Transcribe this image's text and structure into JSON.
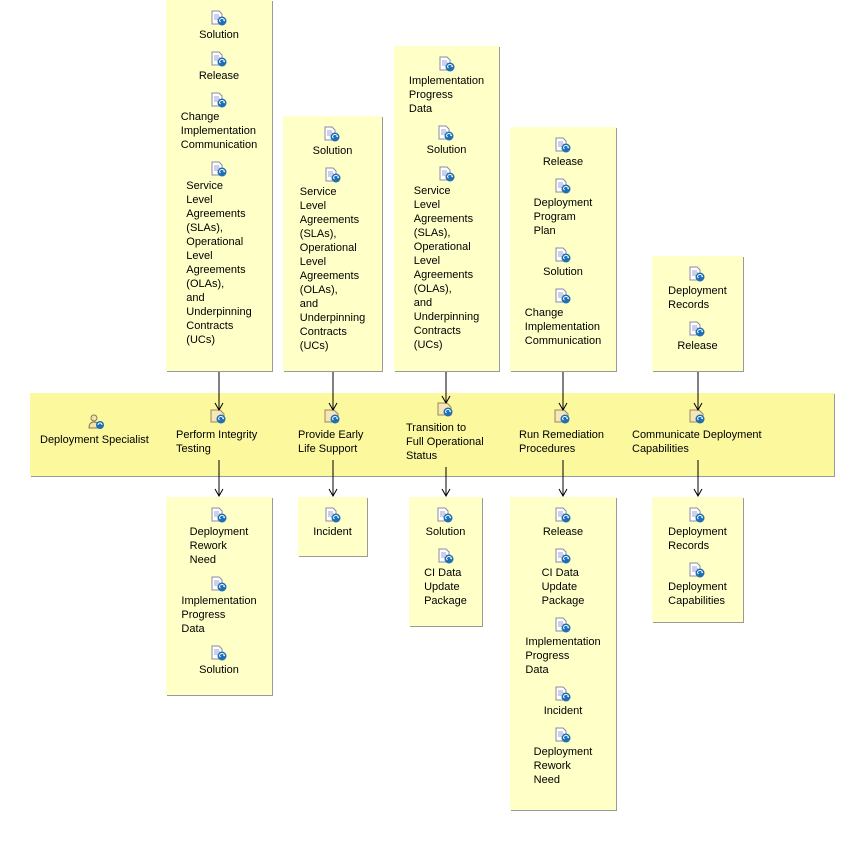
{
  "lane": {
    "role": "Deployment Specialist",
    "role_icon": "role-icon"
  },
  "tasks": [
    {
      "label": "Perform Integrity\nTesting",
      "inputs": [
        "Solution",
        "Release",
        "Change\nImplementation\nCommunication",
        "Service\nLevel\nAgreements\n(SLAs),\nOperational\nLevel\nAgreements\n(OLAs),\nand\nUnderpinning\nContracts\n(UCs)"
      ],
      "outputs": [
        "Deployment\nRework\nNeed",
        "Implementation\nProgress\nData",
        "Solution"
      ]
    },
    {
      "label": "Provide Early\nLife Support",
      "inputs": [
        "Solution",
        "Service\nLevel\nAgreements\n(SLAs),\nOperational\nLevel\nAgreements\n(OLAs),\nand\nUnderpinning\nContracts\n(UCs)"
      ],
      "outputs": [
        "Incident"
      ]
    },
    {
      "label": "Transition to\nFull Operational\nStatus",
      "inputs": [
        "Implementation\nProgress\nData",
        "Solution",
        "Service\nLevel\nAgreements\n(SLAs),\nOperational\nLevel\nAgreements\n(OLAs),\nand\nUnderpinning\nContracts\n(UCs)"
      ],
      "outputs": [
        "Solution",
        "CI Data\nUpdate\nPackage"
      ]
    },
    {
      "label": "Run Remediation\nProcedures",
      "inputs": [
        "Release",
        "Deployment\nProgram\nPlan",
        "Solution",
        "Change\nImplementation\nCommunication"
      ],
      "outputs": [
        "Release",
        "CI Data\nUpdate\nPackage",
        "Implementation\nProgress\nData",
        "Incident",
        "Deployment\nRework\nNeed"
      ]
    },
    {
      "label": "Communicate Deployment\nCapabilities",
      "inputs": [
        "Deployment\nRecords",
        "Release"
      ],
      "outputs": [
        "Deployment\nRecords",
        "Deployment\nCapabilities"
      ]
    }
  ],
  "colors": {
    "lane": "#fbf89e",
    "artifact_box": "#ffffc8",
    "icon_blue": "#1f6fb5"
  }
}
